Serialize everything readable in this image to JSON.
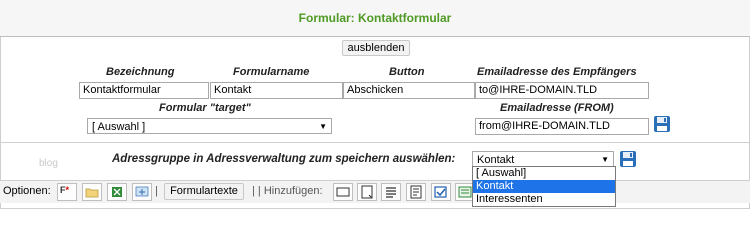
{
  "title": "Formular: Kontaktformular",
  "hide_button": "ausblenden",
  "labels": {
    "bezeichnung": "Bezeichnung",
    "formularname": "Formularname",
    "button": "Button",
    "email_empfaenger": "Emailadresse des Empfängers",
    "target": "Formular \"target\"",
    "email_from": "Emailadresse (FROM)",
    "adressgruppe": "Adressgruppe in Adressverwaltung zum speichern auswählen:"
  },
  "fields": {
    "bezeichnung": "Kontaktformular",
    "formularname": "Kontakt",
    "button": "Abschicken",
    "email_to": "to@IHRE-DOMAIN.TLD",
    "target": "[ Auswahl ]",
    "email_from": "from@IHRE-DOMAIN.TLD",
    "adressgruppe": "Kontakt"
  },
  "dropdown_options": [
    "[ Auswahl]",
    "Kontakt",
    "Interessenten"
  ],
  "dropdown_selected_index": 1,
  "blog_label": "blog",
  "toolbar": {
    "options_label": "Optionen:",
    "formulartexte": "Formulartexte",
    "hinzufuegen": "| | Hinzufügen:",
    "sep1": "|"
  },
  "colors": {
    "title": "#4f9a24",
    "highlight": "#1e73e8"
  }
}
